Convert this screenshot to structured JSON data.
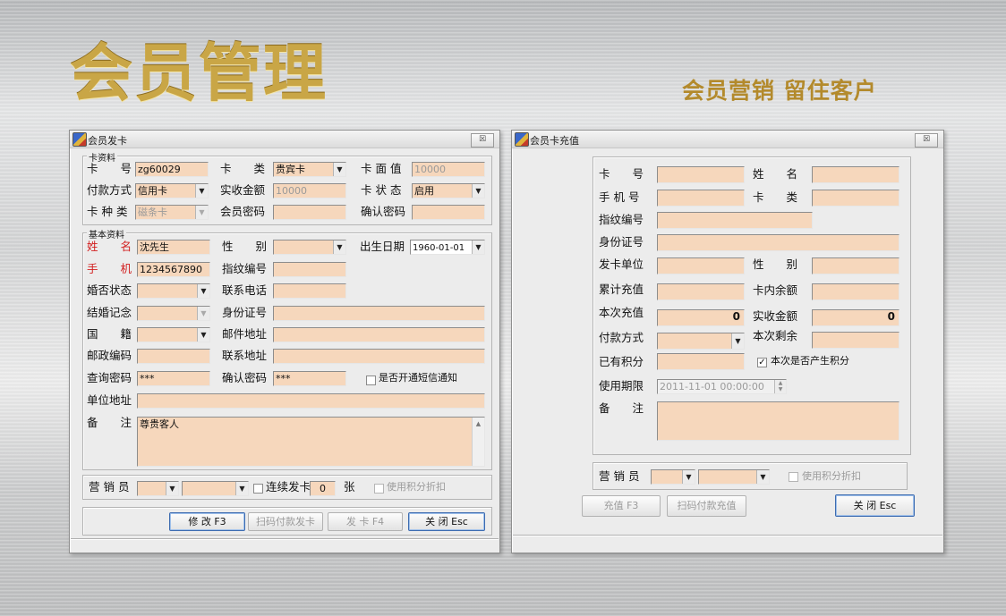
{
  "hero": {
    "title": "会员管理",
    "slogan": "会员营销 留住客户"
  },
  "issue_win": {
    "title": "会员发卡",
    "close": "☒",
    "card_group": "卡资料",
    "card_no_label": "卡　　号",
    "card_no": "zg60029",
    "card_type_label": "卡　　类",
    "card_type": "贵宾卡",
    "face_value_label": "卡 面 值",
    "face_value": "10000",
    "pay_method_label": "付款方式",
    "pay_method": "信用卡",
    "paid_label": "实收金额",
    "paid": "10000",
    "status_label": "卡 状 态",
    "status": "启用",
    "kind_label": "卡 种 类",
    "kind": "磁条卡",
    "pwd_label": "会员密码",
    "pwd": "",
    "pwd_confirm_label": "确认密码",
    "pwd_confirm": "",
    "basic_group": "基本资料",
    "name_label": "姓　　名",
    "name": "沈先生",
    "gender_label": "性　　别",
    "gender": "",
    "birth_label": "出生日期",
    "birth": "1960-01-01",
    "mobile_label": "手　　机",
    "mobile": "1234567890",
    "finger_label": "指纹编号",
    "finger": "",
    "marital_label": "婚否状态",
    "marital": "",
    "phone_label": "联系电话",
    "phone": "",
    "anniv_label": "结婚记念",
    "anniv": "",
    "idcard_label": "身份证号",
    "idcard": "",
    "country_label": "国　　籍",
    "country": "",
    "mail_label": "邮件地址",
    "mail": "",
    "zip_label": "邮政编码",
    "zip": "",
    "addr_label": "联系地址",
    "addr": "",
    "query_pwd_label": "查询密码",
    "query_pwd": "***",
    "confirm_pwd_label": "确认密码",
    "confirm_pwd": "***",
    "sms_label": "是否开通短信通知",
    "company_label": "单位地址",
    "company": "",
    "note_label": "备　　注",
    "note": "尊贵客人",
    "sales_label": "营 销 员",
    "continuous_label": "连续发卡",
    "continuous_count": "0",
    "count_unit": "张",
    "points_discount_label": "使用积分折扣",
    "btn_edit": "修 改 F3",
    "btn_scan": "扫码付款发卡",
    "btn_issue": "发 卡 F4",
    "btn_close": "关 闭 Esc"
  },
  "recharge_win": {
    "title": "会员卡充值",
    "close": "☒",
    "card_no_label": "卡　　号",
    "card_no": "",
    "name_label": "姓　　名",
    "name": "",
    "mobile_label": "手 机 号",
    "mobile": "",
    "card_type_label": "卡　　类",
    "card_type": "",
    "finger_label": "指纹编号",
    "finger": "",
    "idcard_label": "身份证号",
    "idcard": "",
    "issuer_label": "发卡单位",
    "issuer": "",
    "gender_label": "性　　别",
    "gender": "",
    "total_label": "累计充值",
    "total": "",
    "balance_label": "卡内余额",
    "balance": "",
    "this_label": "本次充值",
    "this": "0",
    "paid_label": "实收金额",
    "paid": "0",
    "pay_method_label": "付款方式",
    "pay_method": "",
    "remain_label": "本次剩余",
    "remain": "",
    "points_label": "已有积分",
    "points": "",
    "earn_points_label": "本次是否产生积分",
    "expiry_label": "使用期限",
    "expiry": "2011-11-01 00:00:00",
    "note_label": "备　　注",
    "note": "",
    "sales_label": "营 销 员",
    "points_discount_label": "使用积分折扣",
    "btn_recharge": "充值 F3",
    "btn_scan": "扫码付款充值",
    "btn_close": "关 闭 Esc"
  }
}
